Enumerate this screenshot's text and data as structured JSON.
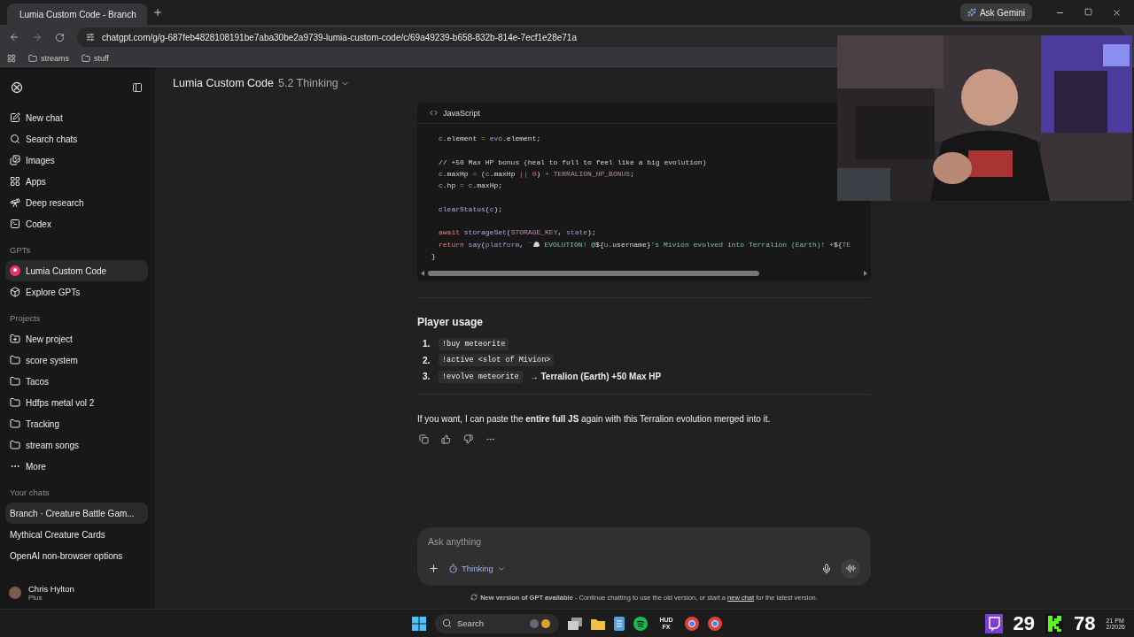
{
  "browser": {
    "tab_title": "Lumia Custom Code - Branch",
    "gemini_button": "Ask Gemini",
    "url": "chatgpt.com/g/g-687feb4828108191be7aba30be2a9739-lumia-custom-code/c/69a49239-b658-832b-814e-7ecf1e28e71a",
    "bookmarks": [
      "streams",
      "stuff"
    ]
  },
  "sidebar": {
    "nav": [
      "New chat",
      "Search chats",
      "Images",
      "Apps",
      "Deep research",
      "Codex"
    ],
    "gpts_heading": "GPTs",
    "gpts": [
      {
        "label": "Lumia Custom Code",
        "selected": true
      },
      {
        "label": "Explore GPTs",
        "selected": false
      }
    ],
    "projects_heading": "Projects",
    "projects": [
      "New project",
      "score system",
      "Tacos",
      "Hdfps metal vol 2",
      "Tracking",
      "stream songs",
      "More"
    ],
    "chats_heading": "Your chats",
    "chats": [
      {
        "label": "Branch · Creature Battle Gam...",
        "selected": true
      },
      {
        "label": "Mythical Creature Cards",
        "selected": false
      },
      {
        "label": "OpenAI non-browser options",
        "selected": false
      }
    ],
    "user": {
      "name": "Chris Hylton",
      "plan": "Plus"
    }
  },
  "header": {
    "title": "Lumia Custom Code",
    "model": "5.2 Thinking"
  },
  "code_block": {
    "language": "JavaScript",
    "lines": [
      {
        "tokens": [
          {
            "kind": "var",
            "text": "c"
          },
          {
            "kind": "plain",
            "text": ".element "
          },
          {
            "kind": "op",
            "text": "="
          },
          {
            "kind": "var",
            "text": " evo"
          },
          {
            "kind": "plain",
            "text": ".element;"
          }
        ]
      },
      {
        "gap_before": true,
        "tokens": [
          {
            "kind": "comment",
            "text": "// +50 Max HP bonus (heal to full to feel like a big evolution)"
          }
        ]
      },
      {
        "tokens": [
          {
            "kind": "var",
            "text": "c"
          },
          {
            "kind": "plain",
            "text": ".maxHp "
          },
          {
            "kind": "op",
            "text": "="
          },
          {
            "kind": "plain",
            "text": " ("
          },
          {
            "kind": "var",
            "text": "c"
          },
          {
            "kind": "plain",
            "text": ".maxHp "
          },
          {
            "kind": "op",
            "text": "||"
          },
          {
            "kind": "number",
            "text": " 0"
          },
          {
            "kind": "plain",
            "text": ") "
          },
          {
            "kind": "op",
            "text": "+"
          },
          {
            "kind": "const",
            "text": " TERRALION_HP_BONUS"
          },
          {
            "kind": "plain",
            "text": ";"
          }
        ]
      },
      {
        "tokens": [
          {
            "kind": "var",
            "text": "c"
          },
          {
            "kind": "plain",
            "text": ".hp "
          },
          {
            "kind": "op",
            "text": "="
          },
          {
            "kind": "var",
            "text": " c"
          },
          {
            "kind": "plain",
            "text": ".maxHp;"
          }
        ]
      },
      {
        "gap_before": true,
        "tokens": [
          {
            "kind": "fn",
            "text": "clearStatus"
          },
          {
            "kind": "plain",
            "text": "("
          },
          {
            "kind": "var",
            "text": "c"
          },
          {
            "kind": "plain",
            "text": ");"
          }
        ]
      },
      {
        "gap_before": true,
        "tokens": [
          {
            "kind": "keyword",
            "text": "await"
          },
          {
            "kind": "fn",
            "text": " storageSet"
          },
          {
            "kind": "plain",
            "text": "("
          },
          {
            "kind": "const",
            "text": "STORAGE_KEY"
          },
          {
            "kind": "plain",
            "text": ", "
          },
          {
            "kind": "var",
            "text": "state"
          },
          {
            "kind": "plain",
            "text": ");"
          }
        ]
      },
      {
        "tokens": [
          {
            "kind": "keyword",
            "text": "return"
          },
          {
            "kind": "fn",
            "text": " say"
          },
          {
            "kind": "plain",
            "text": "("
          },
          {
            "kind": "var",
            "text": "platform"
          },
          {
            "kind": "plain",
            "text": ", "
          },
          {
            "kind": "string",
            "text": "`"
          },
          {
            "kind": "icon"
          },
          {
            "kind": "string",
            "text": " EVOLUTION! @"
          },
          {
            "kind": "plain",
            "text": "${"
          },
          {
            "kind": "var",
            "text": "u"
          },
          {
            "kind": "plain",
            "text": ".username}"
          },
          {
            "kind": "string",
            "text": "'s Mivion evolved into Terralion (Earth)! +"
          },
          {
            "kind": "plain",
            "text": "${"
          },
          {
            "kind": "const",
            "text": "TE"
          }
        ]
      },
      {
        "outdent": true,
        "tokens": [
          {
            "kind": "plain",
            "text": "}"
          }
        ]
      }
    ]
  },
  "usage": {
    "heading": "Player usage",
    "steps": [
      {
        "number": "1.",
        "command": "!buy meteorite"
      },
      {
        "number": "2.",
        "command": "!active <slot of Mivion>"
      },
      {
        "number": "3.",
        "command": "!evolve meteorite",
        "result": "→ Terralion (Earth) +50 Max HP"
      }
    ]
  },
  "closing": "If you want, I can paste the **entire full JS** again with this Terralion evolution merged into it.",
  "composer": {
    "placeholder": "Ask anything",
    "mode": "Thinking"
  },
  "notice": {
    "text": "**New version of GPT available** - Continue chatting to use the old version, or start a ",
    "link": "new chat",
    "tail": " for the latest version."
  },
  "taskbar": {
    "search": "Search",
    "app_label": "HUD FX",
    "counters": [
      "29",
      "78"
    ],
    "clock": [
      "21 PM",
      "2/2026"
    ]
  }
}
